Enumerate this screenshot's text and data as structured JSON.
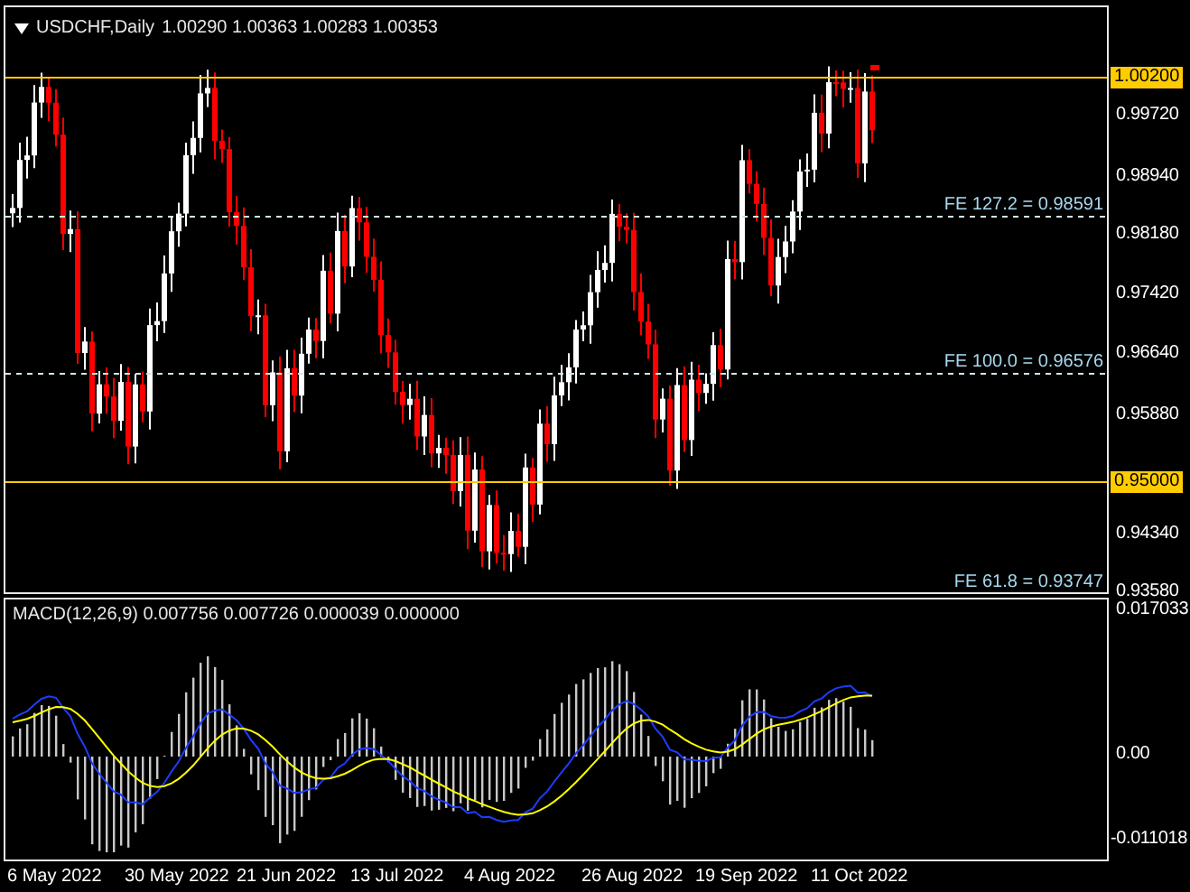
{
  "chart": {
    "symbol": "USDCHF,Daily",
    "ohlc": "1.00290 1.00363 1.00283 1.00353",
    "fe_levels": [
      {
        "label": "FE 127.2 = 0.98591"
      },
      {
        "label": "FE 100.0 = 0.96576"
      },
      {
        "label": "FE 61.8 = 0.93747"
      }
    ],
    "key_levels": [
      {
        "label": "1.00200"
      },
      {
        "label": "0.95000"
      }
    ],
    "price_ticks": [
      "0.99720",
      "0.98940",
      "0.98180",
      "0.97420",
      "0.96640",
      "0.95880",
      "0.94340",
      "0.93580"
    ]
  },
  "macd": {
    "title": "MACD(12,26,9) 0.007756 0.007726 0.000039 0.000000",
    "ticks": [
      "0.017033",
      "0.00",
      "-0.011018"
    ]
  },
  "dates": [
    "6 May 2022",
    "30 May 2022",
    "21 Jun 2022",
    "13 Jul 2022",
    "4 Aug 2022",
    "26 Aug 2022",
    "19 Sep 2022",
    "11 Oct 2022"
  ]
}
